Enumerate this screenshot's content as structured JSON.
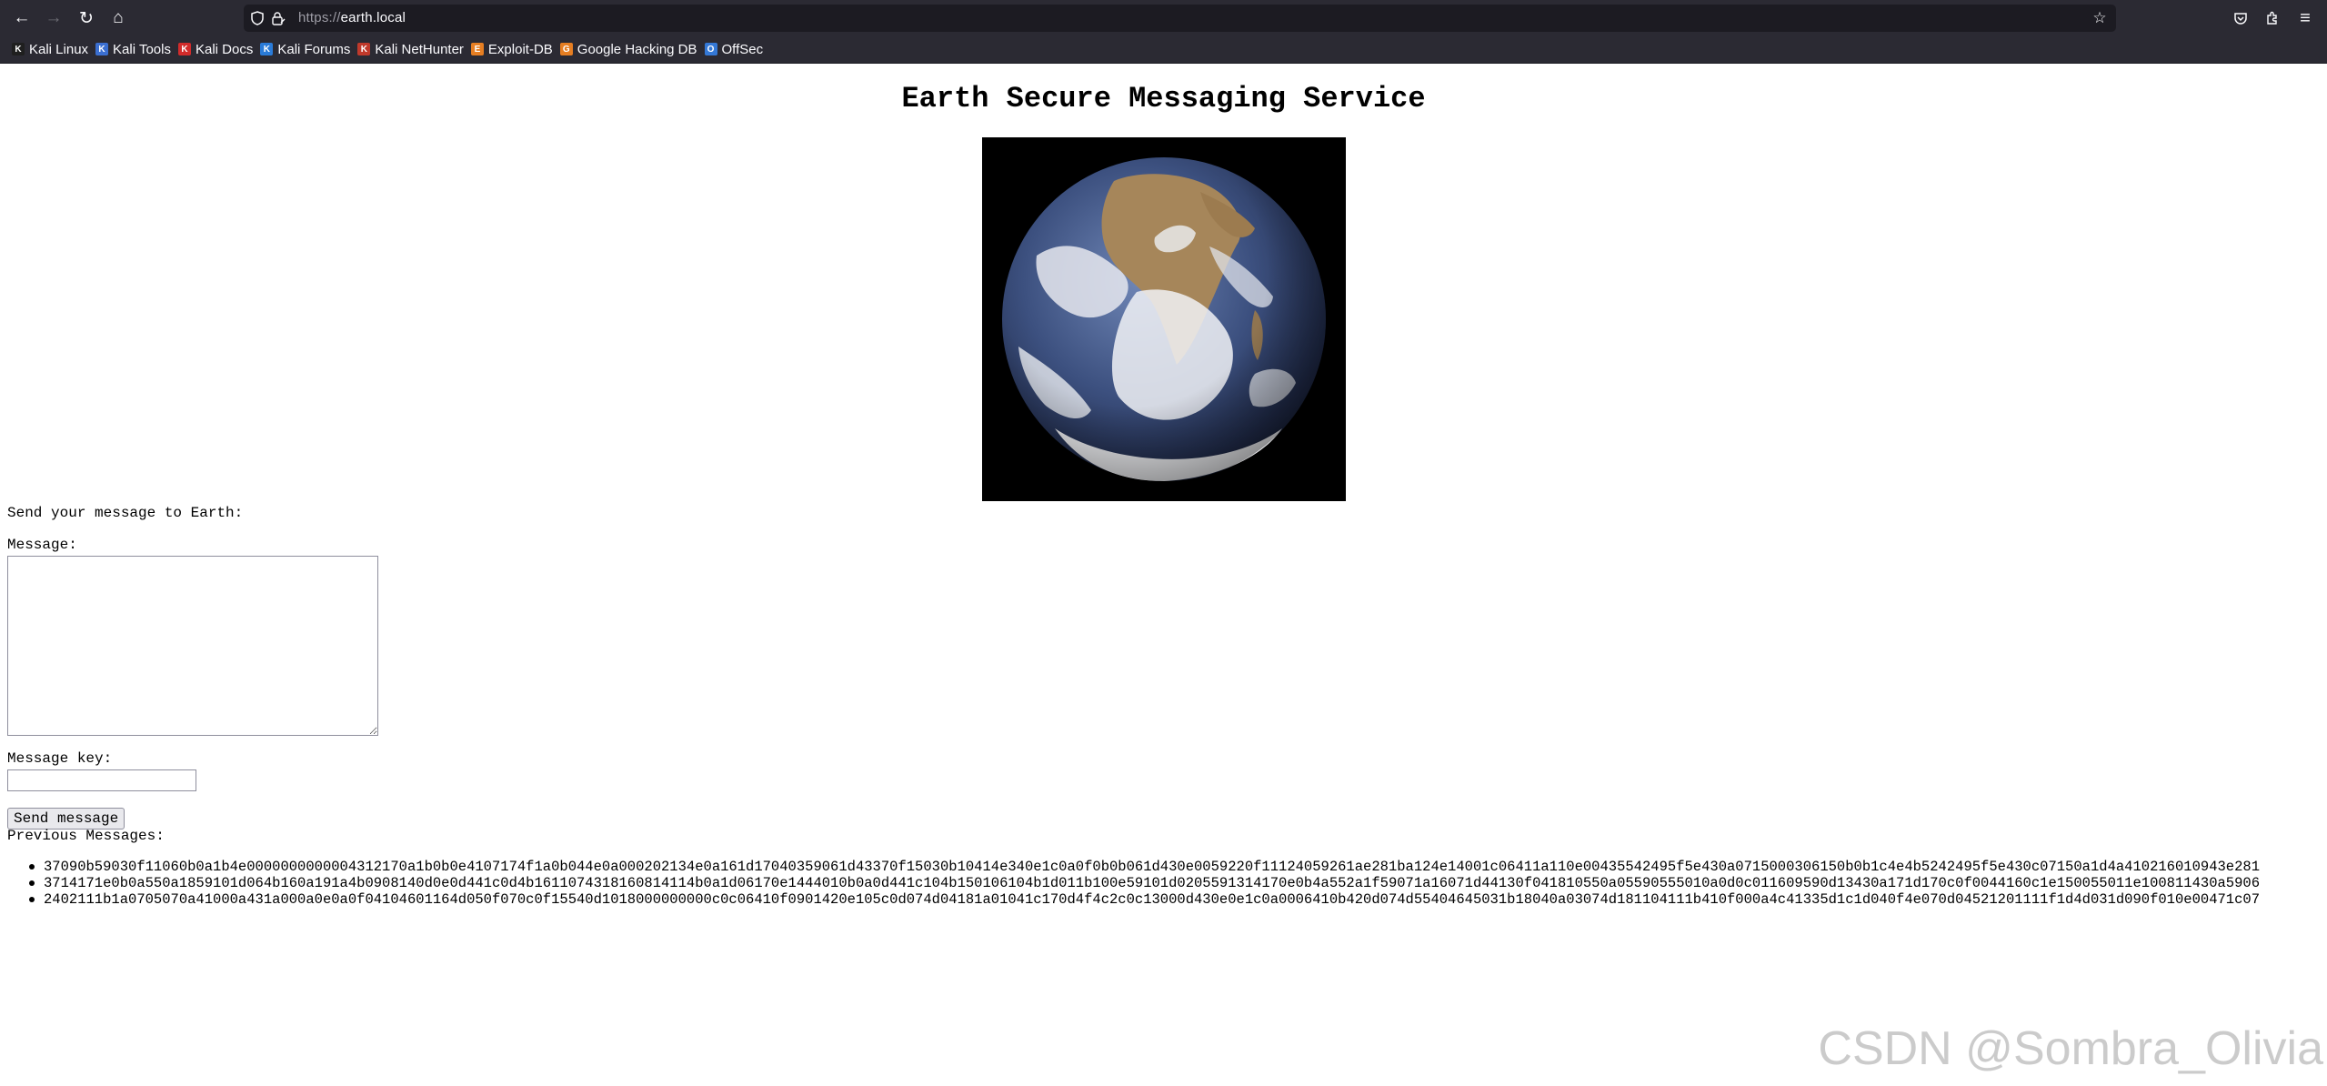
{
  "browser": {
    "url_scheme": "https://",
    "url_host": "earth.local",
    "nav": {
      "back_icon": "←",
      "forward_icon": "→",
      "reload_icon": "↻",
      "home_icon": "⌂"
    },
    "icons": {
      "shield": "shield-icon",
      "lock": "lock-icon",
      "star": "☆",
      "pocket": "pocket-icon",
      "extensions": "extensions-icon",
      "menu": "≡"
    },
    "bookmarks": [
      {
        "label": "Kali Linux",
        "color": "#1f1f1f",
        "glyph": "K"
      },
      {
        "label": "Kali Tools",
        "color": "#3b6fd1",
        "glyph": "K"
      },
      {
        "label": "Kali Docs",
        "color": "#d22b2b",
        "glyph": "K"
      },
      {
        "label": "Kali Forums",
        "color": "#2a7bd8",
        "glyph": "K"
      },
      {
        "label": "Kali NetHunter",
        "color": "#c0392b",
        "glyph": "K"
      },
      {
        "label": "Exploit-DB",
        "color": "#e67e22",
        "glyph": "E"
      },
      {
        "label": "Google Hacking DB",
        "color": "#e67e22",
        "glyph": "G"
      },
      {
        "label": "OffSec",
        "color": "#3478d6",
        "glyph": "O"
      }
    ]
  },
  "page": {
    "title": "Earth Secure Messaging Service",
    "send_prompt": "Send your message to Earth:",
    "message_label": "Message:",
    "message_value": "",
    "key_label": "Message key:",
    "key_value": "",
    "send_button": "Send message",
    "previous_label": "Previous Messages:",
    "messages": [
      "37090b59030f11060b0a1b4e0000000000004312170a1b0b0e4107174f1a0b044e0a000202134e0a161d17040359061d43370f15030b10414e340e1c0a0f0b0b061d430e0059220f11124059261ae281ba124e14001c06411a110e00435542495f5e430a0715000306150b0b1c4e4b5242495f5e430c07150a1d4a410216010943e281",
      "3714171e0b0a550a1859101d064b160a191a4b0908140d0e0d441c0d4b1611074318160814114b0a1d06170e1444010b0a0d441c104b150106104b1d011b100e59101d0205591314170e0b4a552a1f59071a16071d44130f041810550a05590555010a0d0c011609590d13430a171d170c0f0044160c1e150055011e100811430a5906",
      "2402111b1a0705070a41000a431a000a0e0a0f04104601164d050f070c0f15540d1018000000000c0c06410f0901420e105c0d074d04181a01041c170d4f4c2c0c13000d430e0e1c0a0006410b420d074d55404645031b18040a03074d181104111b410f000a4c41335d1c1d040f4e070d04521201111f1d4d031d090f010e00471c07"
    ],
    "watermark": "CSDN @Sombra_Olivia"
  }
}
